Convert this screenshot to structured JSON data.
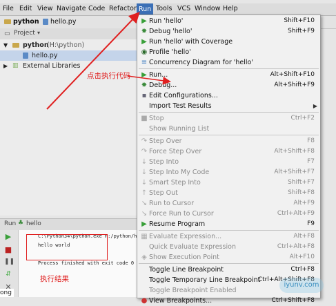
{
  "menubar": {
    "items": [
      "File",
      "Edit",
      "View",
      "Navigate",
      "Code",
      "Refactor",
      "Run",
      "Tools",
      "VCS",
      "Window",
      "Help"
    ]
  },
  "nav": {
    "project": "python",
    "file": "hello.py"
  },
  "project_panel": {
    "header": "Project",
    "root_name": "python",
    "root_path": "(H:\\python)",
    "file": "hello.py",
    "external": "External Libraries"
  },
  "run_panel": {
    "header_run": "Run",
    "header_config": "hello",
    "cmd_line": "C:\\Python34\\python.exe H:/python/h",
    "output": "hello world",
    "exit_line": "Process finished with exit code 0",
    "left_fragment": "ong"
  },
  "run_menu": {
    "items": [
      {
        "label": "Run 'hello'",
        "shortcut": "Shift+F10",
        "icon": "run-icon",
        "disabled": false
      },
      {
        "label": "Debug 'hello'",
        "shortcut": "Shift+F9",
        "icon": "debug-icon",
        "disabled": false
      },
      {
        "label": "Run 'hello' with Coverage",
        "shortcut": "",
        "icon": "coverage-icon",
        "disabled": false
      },
      {
        "label": "Profile 'hello'",
        "shortcut": "",
        "icon": "profile-icon",
        "disabled": false
      },
      {
        "label": "Concurrency Diagram for  'hello'",
        "shortcut": "",
        "icon": "concurrency-icon",
        "disabled": false
      },
      {
        "label": "Run...",
        "shortcut": "Alt+Shift+F10",
        "icon": "run-icon",
        "disabled": false
      },
      {
        "label": "Debug...",
        "shortcut": "Alt+Shift+F9",
        "icon": "debug-icon",
        "disabled": false
      },
      {
        "label": "Edit Configurations...",
        "shortcut": "",
        "icon": "",
        "disabled": false
      },
      {
        "label": "Import Test Results",
        "shortcut": "",
        "icon": "",
        "disabled": false,
        "submenu": true
      },
      {
        "label": "Stop",
        "shortcut": "Ctrl+F2",
        "icon": "stop-icon",
        "disabled": true
      },
      {
        "label": "Show Running List",
        "shortcut": "",
        "icon": "",
        "disabled": true
      },
      {
        "label": "Step Over",
        "shortcut": "F8",
        "icon": "step-over-icon",
        "disabled": true
      },
      {
        "label": "Force Step Over",
        "shortcut": "Alt+Shift+F8",
        "icon": "force-step-over-icon",
        "disabled": true
      },
      {
        "label": "Step Into",
        "shortcut": "F7",
        "icon": "step-into-icon",
        "disabled": true
      },
      {
        "label": "Step Into My Code",
        "shortcut": "Alt+Shift+F7",
        "icon": "step-into-my-code-icon",
        "disabled": true
      },
      {
        "label": "Smart Step Into",
        "shortcut": "Shift+F7",
        "icon": "smart-step-into-icon",
        "disabled": true
      },
      {
        "label": "Step Out",
        "shortcut": "Shift+F8",
        "icon": "step-out-icon",
        "disabled": true
      },
      {
        "label": "Run to Cursor",
        "shortcut": "Alt+F9",
        "icon": "run-to-cursor-icon",
        "disabled": true
      },
      {
        "label": "Force Run to Cursor",
        "shortcut": "Ctrl+Alt+F9",
        "icon": "force-run-to-cursor-icon",
        "disabled": true
      },
      {
        "label": "Resume Program",
        "shortcut": "F9",
        "icon": "resume-icon",
        "disabled": false
      },
      {
        "label": "Evaluate Expression...",
        "shortcut": "Alt+F8",
        "icon": "evaluate-icon",
        "disabled": true
      },
      {
        "label": "Quick Evaluate Expression",
        "shortcut": "Ctrl+Alt+F8",
        "icon": "",
        "disabled": true
      },
      {
        "label": "Show Execution Point",
        "shortcut": "Alt+F10",
        "icon": "execution-point-icon",
        "disabled": true
      },
      {
        "label": "Toggle Line Breakpoint",
        "shortcut": "Ctrl+F8",
        "icon": "",
        "disabled": false
      },
      {
        "label": "Toggle Temporary Line Breakpoint",
        "shortcut": "Ctrl+Alt+Shift+F8",
        "icon": "",
        "disabled": false
      },
      {
        "label": "Toggle Breakpoint Enabled",
        "shortcut": "",
        "icon": "",
        "disabled": true
      },
      {
        "label": "View Breakpoints...",
        "shortcut": "Ctrl+Shift+F8",
        "icon": "breakpoints-icon",
        "disabled": false
      }
    ]
  },
  "annotations": {
    "click_to_run": "点击执行代码",
    "run_result": "执行结果"
  },
  "watermark": "iyunv.com",
  "colors": {
    "accent": "#3b6fb6",
    "annotation": "#e02020",
    "run_green": "#3aa03a"
  }
}
